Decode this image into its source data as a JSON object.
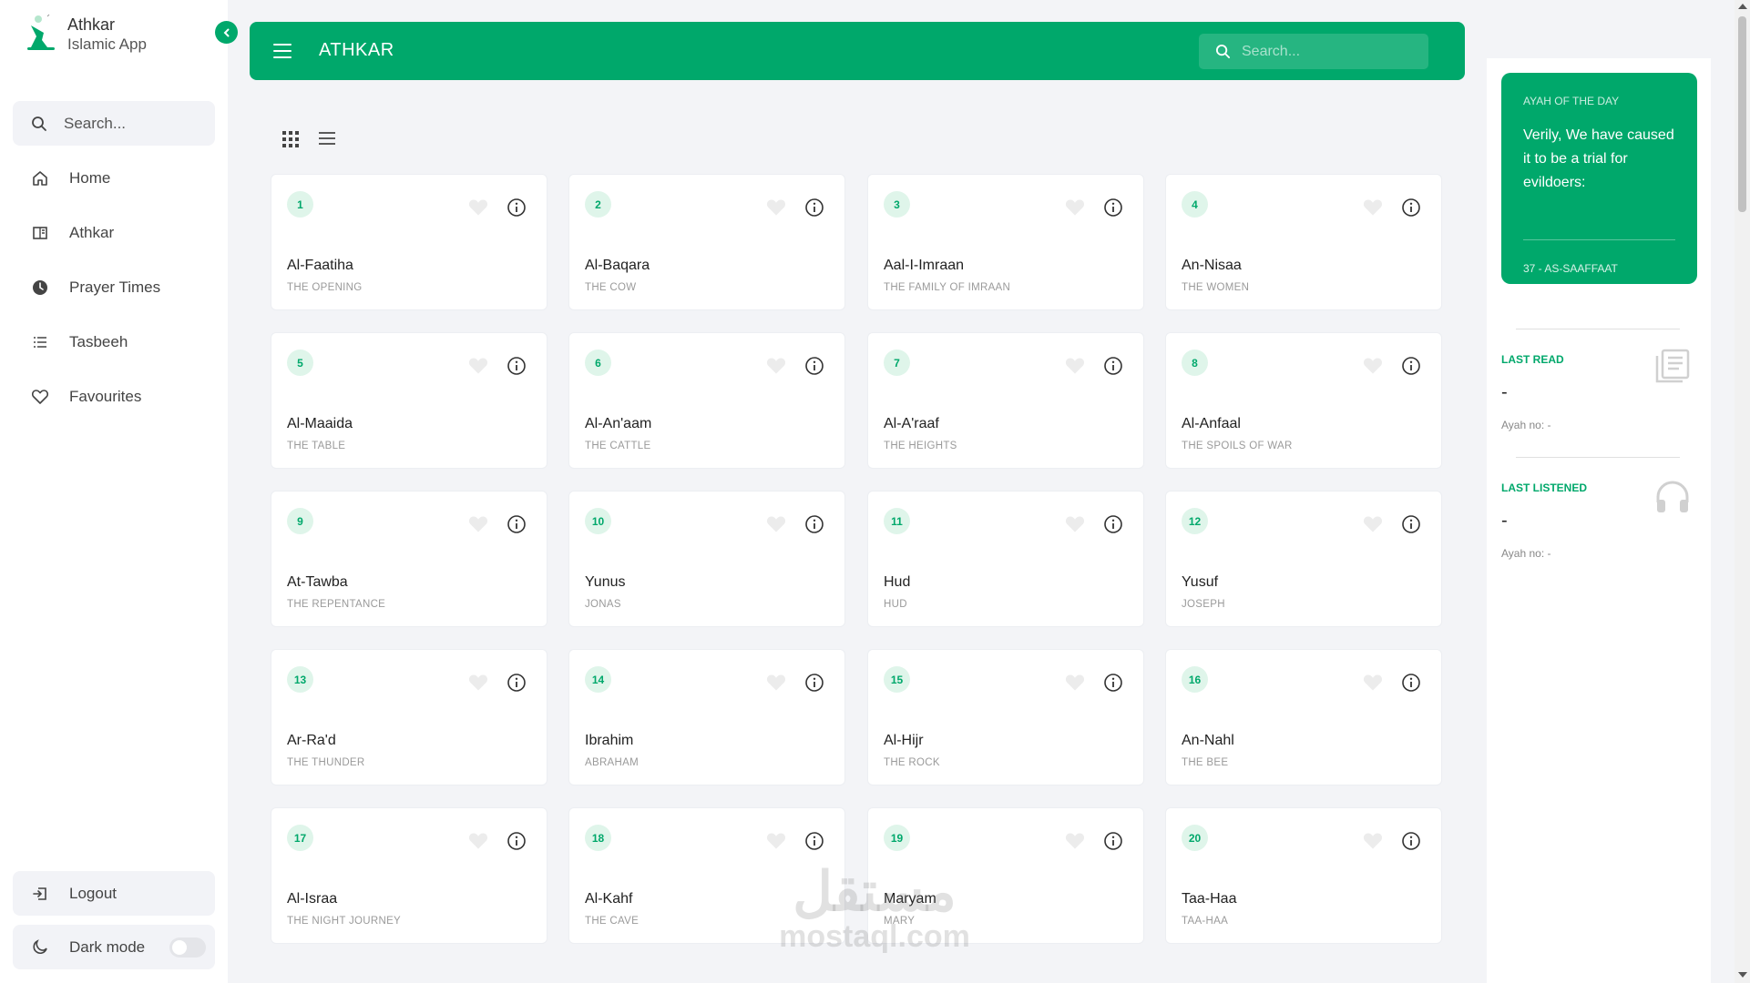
{
  "brand": {
    "title": "Athkar",
    "subtitle": "Islamic App"
  },
  "sidebar": {
    "search_placeholder": "Search...",
    "items": [
      {
        "label": "Home",
        "icon": "home-icon"
      },
      {
        "label": "Athkar",
        "icon": "book-icon"
      },
      {
        "label": "Prayer Times",
        "icon": "clock-icon"
      },
      {
        "label": "Tasbeeh",
        "icon": "list-icon"
      },
      {
        "label": "Favourites",
        "icon": "heart-icon"
      }
    ],
    "logout_label": "Logout",
    "darkmode_label": "Dark mode",
    "darkmode_on": false
  },
  "header": {
    "title": "ATHKAR",
    "search_placeholder": "Search..."
  },
  "surahs": [
    {
      "num": "1",
      "name": "Al-Faatiha",
      "meaning": "THE OPENING"
    },
    {
      "num": "2",
      "name": "Al-Baqara",
      "meaning": "THE COW"
    },
    {
      "num": "3",
      "name": "Aal-I-Imraan",
      "meaning": "THE FAMILY OF IMRAAN"
    },
    {
      "num": "4",
      "name": "An-Nisaa",
      "meaning": "THE WOMEN"
    },
    {
      "num": "5",
      "name": "Al-Maaida",
      "meaning": "THE TABLE"
    },
    {
      "num": "6",
      "name": "Al-An'aam",
      "meaning": "THE CATTLE"
    },
    {
      "num": "7",
      "name": "Al-A'raaf",
      "meaning": "THE HEIGHTS"
    },
    {
      "num": "8",
      "name": "Al-Anfaal",
      "meaning": "THE SPOILS OF WAR"
    },
    {
      "num": "9",
      "name": "At-Tawba",
      "meaning": "THE REPENTANCE"
    },
    {
      "num": "10",
      "name": "Yunus",
      "meaning": "JONAS"
    },
    {
      "num": "11",
      "name": "Hud",
      "meaning": "HUD"
    },
    {
      "num": "12",
      "name": "Yusuf",
      "meaning": "JOSEPH"
    },
    {
      "num": "13",
      "name": "Ar-Ra'd",
      "meaning": "THE THUNDER"
    },
    {
      "num": "14",
      "name": "Ibrahim",
      "meaning": "ABRAHAM"
    },
    {
      "num": "15",
      "name": "Al-Hijr",
      "meaning": "THE ROCK"
    },
    {
      "num": "16",
      "name": "An-Nahl",
      "meaning": "THE BEE"
    },
    {
      "num": "17",
      "name": "Al-Israa",
      "meaning": "THE NIGHT JOURNEY"
    },
    {
      "num": "18",
      "name": "Al-Kahf",
      "meaning": "THE CAVE"
    },
    {
      "num": "19",
      "name": "Maryam",
      "meaning": "MARY"
    },
    {
      "num": "20",
      "name": "Taa-Haa",
      "meaning": "TAA-HAA"
    }
  ],
  "ayah_of_day": {
    "label": "AYAH OF THE DAY",
    "text": "Verily, We have caused it to be a trial for evildoers:",
    "reference": "37 - AS-SAAFFAAT"
  },
  "last_read": {
    "label": "LAST READ",
    "value": "-",
    "sub": "Ayah no: -"
  },
  "last_listened": {
    "label": "LAST LISTENED",
    "value": "-",
    "sub": "Ayah no: -"
  },
  "watermark": {
    "arabic": "مستقل",
    "latin": "mostaql.com"
  },
  "colors": {
    "accent": "#00a86b",
    "badge_bg": "#dff5ea"
  }
}
